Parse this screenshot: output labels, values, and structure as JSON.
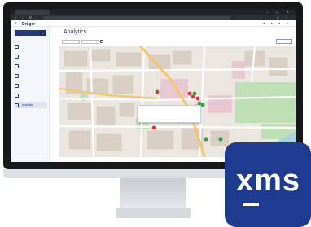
{
  "browser": {
    "tab_title": "",
    "url": ""
  },
  "header": {
    "brand": "Dräger",
    "product": "",
    "icons": [
      "menu-icon",
      "bell-icon",
      "help-icon",
      "user-icon"
    ]
  },
  "sidebar": {
    "site_select": "",
    "items": [
      {
        "label": "",
        "icon": "building-icon"
      },
      {
        "label": "",
        "icon": "device-icon"
      },
      {
        "label": "",
        "icon": "calendar-icon"
      },
      {
        "label": "",
        "icon": "calendar-icon"
      },
      {
        "label": "",
        "icon": "document-icon"
      },
      {
        "label": "",
        "icon": "list-icon"
      },
      {
        "label": "Analytics",
        "icon": "chart-icon",
        "active": true
      }
    ],
    "footer_label": ""
  },
  "main": {
    "title": "Analytics",
    "filters_label": "",
    "date_from": "",
    "date_to": "",
    "filter_text": "",
    "reset_label": ""
  },
  "map": {
    "popup_lines": [
      "",
      "",
      "",
      "",
      ""
    ]
  },
  "badge": {
    "text": "xms",
    "color": "#1f3b8f"
  },
  "colors": {
    "accent": "#233a7d",
    "marker_red": "#d9363e",
    "marker_green": "#3c9a4c"
  }
}
